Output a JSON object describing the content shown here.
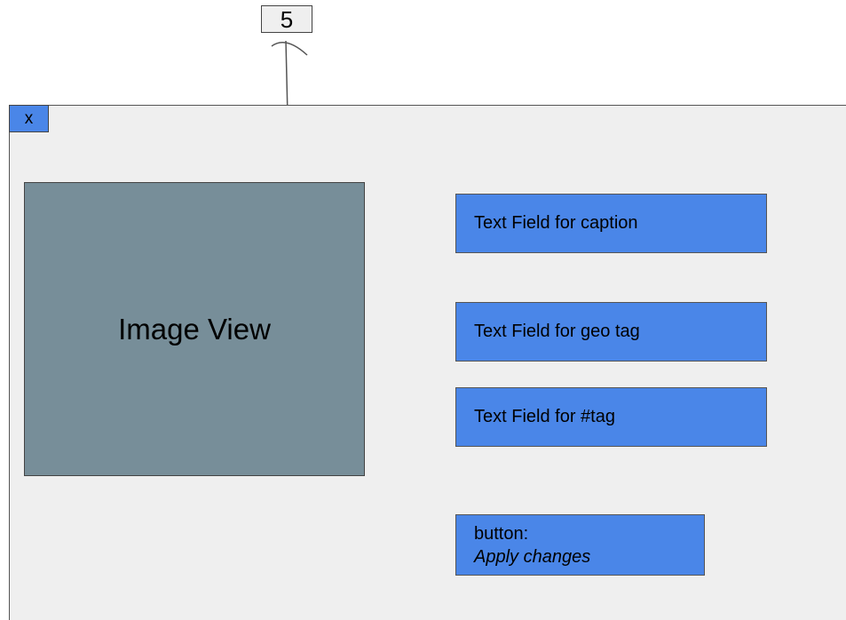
{
  "callout": {
    "number": "5"
  },
  "window": {
    "close_label": "x",
    "image_view_label": "Image View",
    "fields": {
      "caption": "Text Field for caption",
      "geo_tag": "Text Field for geo tag",
      "hashtag": "Text Field for #tag"
    },
    "apply_button": {
      "prefix": "button:",
      "label": "Apply changes"
    }
  },
  "colors": {
    "accent_blue": "#4a86e8",
    "image_gray": "#778e99",
    "window_bg": "#efefef"
  }
}
